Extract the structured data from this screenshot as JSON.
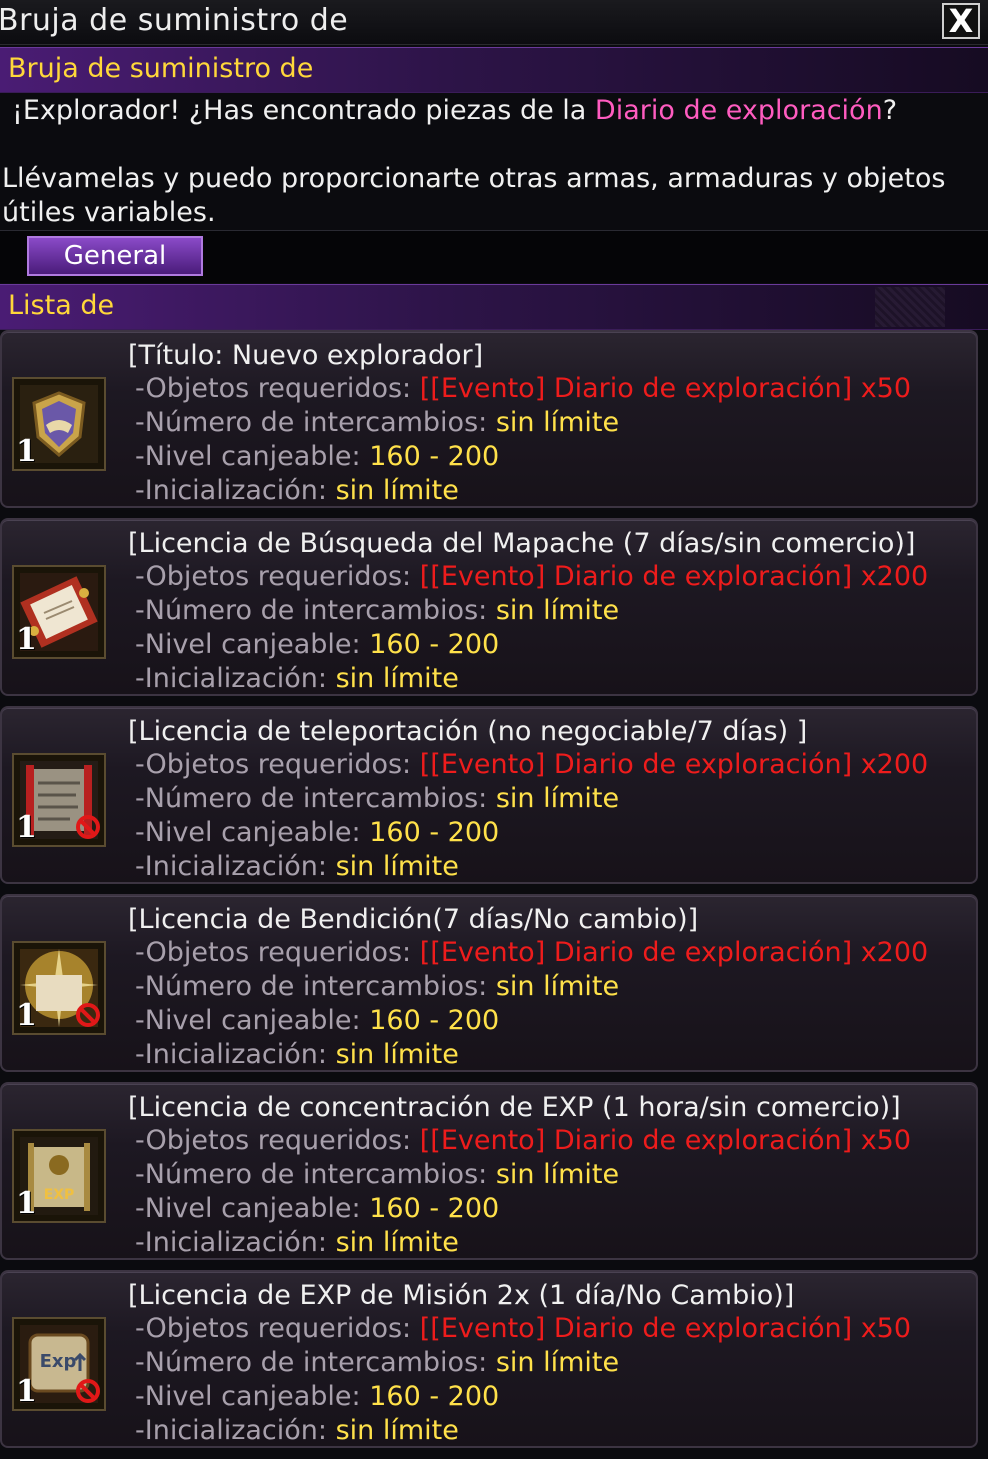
{
  "window": {
    "title": "Bruja de suministro de",
    "close_label": "X"
  },
  "npc_header": "Bruja de suministro de",
  "intro": {
    "line1_prefix": "¡Explorador! ¿Has encontrado piezas de la ",
    "line1_highlight": "Diario de exploración",
    "line1_suffix": "?",
    "line2": "Llévamelas y puedo proporcionarte otras armas, armaduras y objetos útiles variables."
  },
  "tabs": [
    {
      "label": "General"
    }
  ],
  "list_header": "Lista de",
  "labels": {
    "required": "-Objetos requeridos:",
    "exchanges": "-Número de intercambios:",
    "level": "-Nivel canjeable:",
    "reset": "-Inicialización:"
  },
  "items": [
    {
      "name": "[Título: Nuevo explorador]",
      "quantity": "1",
      "required": "[[Evento] Diario de exploración] x50",
      "exchanges": "sin límite",
      "level": "160 - 200",
      "reset": "sin límite",
      "icon": "title-badge-icon",
      "no_trade": false
    },
    {
      "name": "[Licencia de Búsqueda del Mapache (7 días/sin comercio)]",
      "quantity": "1",
      "required": "[[Evento] Diario de exploración] x200",
      "exchanges": "sin límite",
      "level": "160 - 200",
      "reset": "sin límite",
      "icon": "scroll-icon",
      "no_trade": false
    },
    {
      "name": "[Licencia de teleportación (no negociable/7 días) ]",
      "quantity": "1",
      "required": "[[Evento] Diario de exploración] x200",
      "exchanges": "sin límite",
      "level": "160 - 200",
      "reset": "sin límite",
      "icon": "map-scroll-icon",
      "no_trade": true
    },
    {
      "name": "[Licencia de Bendición(7 días/No cambio)]",
      "quantity": "1",
      "required": "[[Evento] Diario de exploración] x200",
      "exchanges": "sin límite",
      "level": "160 - 200",
      "reset": "sin límite",
      "icon": "blessing-scroll-icon",
      "no_trade": true
    },
    {
      "name": "[Licencia de concentración de EXP (1 hora/sin comercio)]",
      "quantity": "1",
      "required": "[[Evento] Diario de exploración] x50",
      "exchanges": "sin límite",
      "level": "160 - 200",
      "reset": "sin límite",
      "icon": "exp-concentration-icon",
      "no_trade": false
    },
    {
      "name": "[Licencia de EXP de Misión 2x (1 día/No Cambio)]",
      "quantity": "1",
      "required": "[[Evento] Diario de exploración] x50",
      "exchanges": "sin límite",
      "level": "160 - 200",
      "reset": "sin límite",
      "icon": "exp-mission-scroll-icon",
      "no_trade": true
    }
  ],
  "colors": {
    "accent_purple": "#4a1c74",
    "header_yellow": "#ffd83a",
    "required_red": "#ee1c1c",
    "value_yellow": "#ffe14a",
    "highlight_pink": "#ff5cc0"
  }
}
